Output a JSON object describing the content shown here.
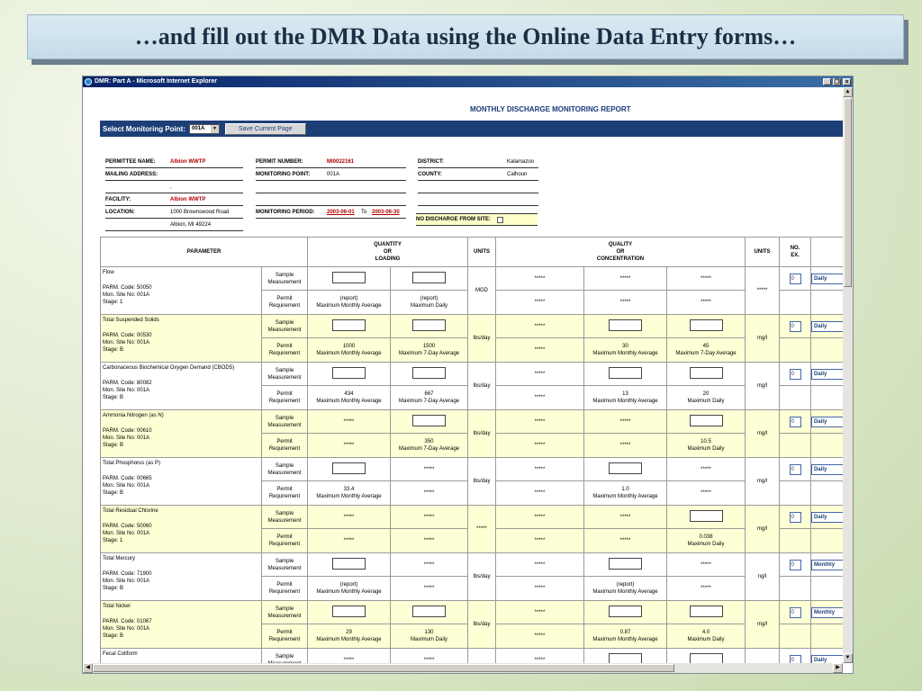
{
  "slide": {
    "title": "…and fill out the DMR Data using the Online Data Entry forms…"
  },
  "window": {
    "title": "DMR: Part A - Microsoft Internet Explorer",
    "minimize": "_",
    "restore": "❐",
    "close": "×"
  },
  "report": {
    "title": "MONTHLY DISCHARGE MONITORING REPORT",
    "select_label": "Select Monitoring Point:",
    "selected_point": "001A",
    "save_label": "Save Current Page"
  },
  "header": {
    "permittee_label": "PERMITTEE NAME:",
    "permittee": "Albion WWTP",
    "mailing_label": "MAILING ADDRESS:",
    "mailing_line2": ",",
    "facility_label": "FACILITY:",
    "facility": "Albion WWTP",
    "location_label": "LOCATION:",
    "location_line1": "1000 Brownswood Road",
    "location_line2": "Albion, MI 49224",
    "permit_label": "PERMIT NUMBER:",
    "permit": "MI0022161",
    "mpoint_label": "MONITORING POINT:",
    "mpoint": "001A",
    "period_label": "MONITORING PERIOD:",
    "period_start": "2003-06-01",
    "period_to": "To",
    "period_end": "2003-06-30",
    "district_label": "DISTRICT:",
    "district": "Kalamazoo",
    "county_label": "COUNTY:",
    "county": "Calhoun",
    "no_discharge_label": "NO DISCHARGE FROM SITE:"
  },
  "table": {
    "h_parameter": "PARAMETER",
    "h_quantity": [
      "QUANTITY",
      "OR",
      "LOADING"
    ],
    "h_units": "UNITS",
    "h_quality": [
      "QUALITY",
      "OR",
      "CONCENTRATION"
    ],
    "h_units2": "UNITS",
    "h_noex": [
      "NO.",
      "EX."
    ],
    "sample_label": [
      "Sample",
      "Measurement"
    ],
    "permit_label": [
      "Permit",
      "Requirement"
    ],
    "rows": [
      {
        "name": "Flow",
        "code": "PARM. Code:   50050",
        "site": "Mon. Site No:   001A",
        "stage": "Stage:   1",
        "q1": "input",
        "q2": "input",
        "p1": [
          "(report)",
          "Maximum Monthly Average"
        ],
        "p2": [
          "(report)",
          "Maximum Daily"
        ],
        "units": "MGD",
        "c1": "*****",
        "c2": "*****",
        "c3": "*****",
        "cp1": [
          "*****"
        ],
        "cp2": [
          "*****"
        ],
        "cp3": [
          "*****"
        ],
        "units2": "*****",
        "noex": "0",
        "freq": "Daily"
      },
      {
        "name": "Total Suspended Solids",
        "code": "PARM. Code:   00530",
        "site": "Mon. Site No:   001A",
        "stage": "Stage:   B",
        "q1": "input",
        "q2": "input",
        "p1": [
          "1000",
          "Maximum Monthly Average"
        ],
        "p2": [
          "1500",
          "Maximum 7-Day Average"
        ],
        "units": "lbs/day",
        "c1": "*****",
        "c2": "input",
        "c3": "input",
        "cp1": [
          "*****"
        ],
        "cp2": [
          "30",
          "Maximum Monthly Average"
        ],
        "cp3": [
          "45",
          "Maximum 7-Day Average"
        ],
        "units2": "mg/l",
        "noex": "0",
        "freq": "Daily"
      },
      {
        "name": "Carbonaceous Biochemical Oxygen Demand (CBOD5)",
        "code": "PARM. Code:   80082",
        "site": "Mon. Site No:   001A",
        "stage": "Stage:   B",
        "q1": "input",
        "q2": "input",
        "p1": [
          "434",
          "Maximum Monthly Average"
        ],
        "p2": [
          "667",
          "Maximum 7-Day Average"
        ],
        "units": "lbs/day",
        "c1": "*****",
        "c2": "input",
        "c3": "input",
        "cp1": [
          "*****"
        ],
        "cp2": [
          "13",
          "Maximum Monthly Average"
        ],
        "cp3": [
          "20",
          "Maximum Daily"
        ],
        "units2": "mg/l",
        "noex": "0",
        "freq": "Daily"
      },
      {
        "name": "Ammonia Nitrogen (as N)",
        "code": "PARM. Code:   00610",
        "site": "Mon. Site No:   001A",
        "stage": "Stage:   B",
        "q1": "*****",
        "q2": "input",
        "p1": [
          "*****"
        ],
        "p2": [
          "350",
          "Maximum 7-Day Average"
        ],
        "units": "lbs/day",
        "c1": "*****",
        "c2": "*****",
        "c3": "input",
        "cp1": [
          "*****"
        ],
        "cp2": [
          "*****"
        ],
        "cp3": [
          "10.5",
          "Maximum Daily"
        ],
        "units2": "mg/l",
        "noex": "0",
        "freq": "Daily"
      },
      {
        "name": "Total Phosphorus (as P)",
        "code": "PARM. Code:   00665",
        "site": "Mon. Site No:   001A",
        "stage": "Stage:   B",
        "q1": "input",
        "q2": "*****",
        "p1": [
          "33.4",
          "Maximum Monthly Average"
        ],
        "p2": [
          "*****"
        ],
        "units": "lbs/day",
        "c1": "*****",
        "c2": "input",
        "c3": "*****",
        "cp1": [
          "*****"
        ],
        "cp2": [
          "1.0",
          "Maximum Monthly Average"
        ],
        "cp3": [
          "*****"
        ],
        "units2": "mg/l",
        "noex": "0",
        "freq": "Daily"
      },
      {
        "name": "Total Residual Chlorine",
        "code": "PARM. Code:   50060",
        "site": "Mon. Site No:   001A",
        "stage": "Stage:   1",
        "q1": "*****",
        "q2": "*****",
        "p1": [
          "*****"
        ],
        "p2": [
          "*****"
        ],
        "units": "*****",
        "c1": "*****",
        "c2": "*****",
        "c3": "input",
        "cp1": [
          "*****"
        ],
        "cp2": [
          "*****"
        ],
        "cp3": [
          "0.038",
          "Maximum Daily"
        ],
        "units2": "mg/l",
        "noex": "0",
        "freq": "Daily"
      },
      {
        "name": "Total Mercury",
        "code": "PARM. Code:   71900",
        "site": "Mon. Site No:   001A",
        "stage": "Stage:   B",
        "q1": "input",
        "q2": "*****",
        "p1": [
          "(report)",
          "Maximum Monthly Average"
        ],
        "p2": [
          "*****"
        ],
        "units": "lbs/day",
        "c1": "*****",
        "c2": "input",
        "c3": "*****",
        "cp1": [
          "*****"
        ],
        "cp2": [
          "(report)",
          "Maximum Monthly Average"
        ],
        "cp3": [
          "*****"
        ],
        "units2": "ng/l",
        "noex": "0",
        "freq": "Monthly"
      },
      {
        "name": "Total Nickel",
        "code": "PARM. Code:   01067",
        "site": "Mon. Site No:   001A",
        "stage": "Stage:   B",
        "q1": "input",
        "q2": "input",
        "p1": [
          "29",
          "Maximum Monthly Average"
        ],
        "p2": [
          "130",
          "Maximum Daily"
        ],
        "units": "lbs/day",
        "c1": "*****",
        "c2": "input",
        "c3": "input",
        "cp1": [
          "*****"
        ],
        "cp2": [
          "0.87",
          "Maximum Monthly Average"
        ],
        "cp3": [
          "4.0",
          "Maximum Daily"
        ],
        "units2": "mg/l",
        "noex": "0",
        "freq": "Monthly"
      },
      {
        "name": "Fecal Coliform",
        "code": "",
        "site": "",
        "stage": "",
        "q1": "*****",
        "q2": "*****",
        "p1": [
          ""
        ],
        "p2": [
          ""
        ],
        "units": "",
        "c1": "*****",
        "c2": "input",
        "c3": "input",
        "cp1": [
          ""
        ],
        "cp2": [
          ""
        ],
        "cp3": [
          ""
        ],
        "units2": "",
        "noex": "0",
        "freq": "Daily"
      }
    ]
  }
}
